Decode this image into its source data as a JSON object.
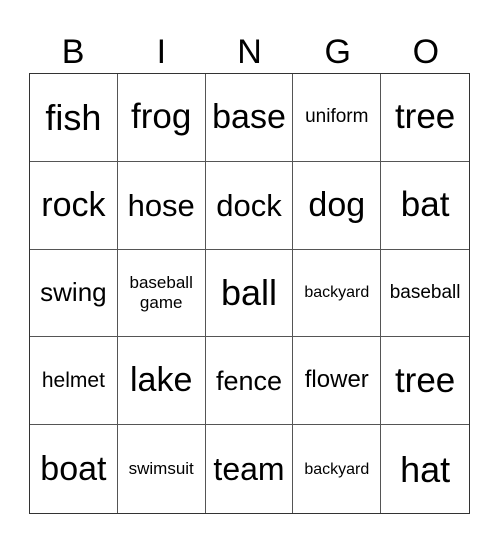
{
  "card": {
    "header": [
      "B",
      "I",
      "N",
      "G",
      "O"
    ],
    "rows": [
      [
        {
          "text": "fish",
          "size": 36
        },
        {
          "text": "frog",
          "size": 35
        },
        {
          "text": "base",
          "size": 34
        },
        {
          "text": "uniform",
          "size": 19
        },
        {
          "text": "tree",
          "size": 35
        }
      ],
      [
        {
          "text": "rock",
          "size": 34
        },
        {
          "text": "hose",
          "size": 31
        },
        {
          "text": "dock",
          "size": 31
        },
        {
          "text": "dog",
          "size": 34
        },
        {
          "text": "bat",
          "size": 35
        }
      ],
      [
        {
          "text": "swing",
          "size": 26
        },
        {
          "text": "baseball game",
          "size": 17
        },
        {
          "text": "ball",
          "size": 36
        },
        {
          "text": "backyard",
          "size": 16
        },
        {
          "text": "baseball",
          "size": 19
        }
      ],
      [
        {
          "text": "helmet",
          "size": 21
        },
        {
          "text": "lake",
          "size": 34
        },
        {
          "text": "fence",
          "size": 27
        },
        {
          "text": "flower",
          "size": 24
        },
        {
          "text": "tree",
          "size": 35
        }
      ],
      [
        {
          "text": "boat",
          "size": 34
        },
        {
          "text": "swimsuit",
          "size": 17
        },
        {
          "text": "team",
          "size": 32
        },
        {
          "text": "backyard",
          "size": 16
        },
        {
          "text": "hat",
          "size": 36
        }
      ]
    ]
  },
  "colors": {
    "background": "#ffffff",
    "text": "#000000",
    "grid_line": "#555555",
    "outer_border": "#333333"
  }
}
